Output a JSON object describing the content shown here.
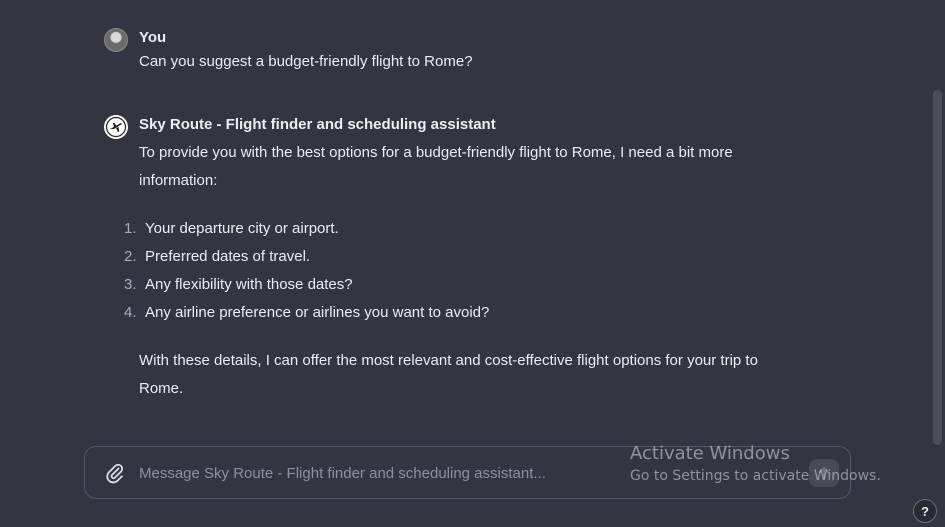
{
  "conversation": {
    "user_message": {
      "author": "You",
      "text": "Can you suggest a budget-friendly flight to Rome?"
    },
    "assistant_message": {
      "author": "Sky Route - Flight finder and scheduling assistant",
      "intro_line1": "To provide you with the best options for a budget-friendly flight to Rome, I need a bit more",
      "intro_line2": "information:",
      "list": [
        {
          "num": "1.",
          "text": "Your departure city or airport."
        },
        {
          "num": "2.",
          "text": "Preferred dates of travel."
        },
        {
          "num": "3.",
          "text": "Any flexibility with those dates?"
        },
        {
          "num": "4.",
          "text": "Any airline preference or airlines you want to avoid?"
        }
      ],
      "outro_line1": "With these details, I can offer the most relevant and cost-effective flight options for your trip to",
      "outro_line2": "Rome."
    }
  },
  "composer": {
    "placeholder": "Message Sky Route - Flight finder and scheduling assistant...",
    "value": ""
  },
  "watermark": {
    "title": "Activate Windows",
    "subtitle": "Go to Settings to activate Windows."
  },
  "help": {
    "label": "?"
  },
  "icons": {
    "attach": "paperclip-icon",
    "send": "arrow-up-icon",
    "bot_avatar": "airplane-icon"
  }
}
